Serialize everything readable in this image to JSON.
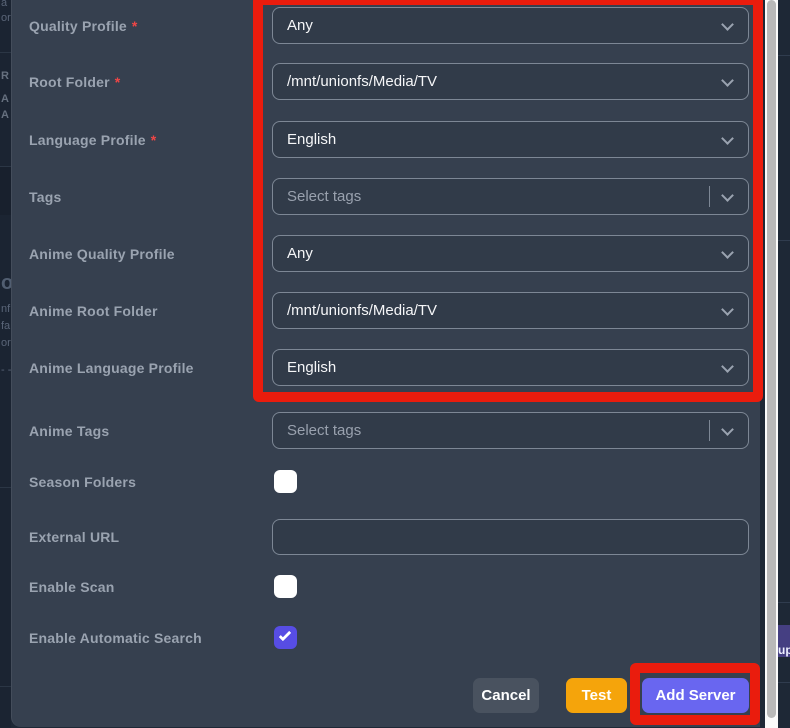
{
  "colors": {
    "annotation_red": "#ea1c0d",
    "panel_bg": "#36404f",
    "page_bg": "#1e2836",
    "add_server_indigo": "#6966f0",
    "checkbox_checked_indigo": "#574de4",
    "test_amber": "#f5a40b",
    "cancel_gray": "#49525f",
    "scrollbar_thumb_gray": "#b9b9b9"
  },
  "form": {
    "required_marker": "*",
    "rows": [
      {
        "label": "Quality Profile",
        "required": true,
        "type": "select",
        "value": "Any"
      },
      {
        "label": "Root Folder",
        "required": true,
        "type": "select",
        "value": "/mnt/unionfs/Media/TV"
      },
      {
        "label": "Language Profile",
        "required": true,
        "type": "select",
        "value": "English"
      },
      {
        "label": "Tags",
        "required": false,
        "type": "multiselect",
        "placeholder": "Select tags"
      },
      {
        "label": "Anime Quality Profile",
        "required": false,
        "type": "select",
        "value": "Any"
      },
      {
        "label": "Anime Root Folder",
        "required": false,
        "type": "select",
        "value": "/mnt/unionfs/Media/TV"
      },
      {
        "label": "Anime Language Profile",
        "required": false,
        "type": "select",
        "value": "English"
      },
      {
        "label": "Anime Tags",
        "required": false,
        "type": "multiselect",
        "placeholder": "Select tags"
      },
      {
        "label": "Season Folders",
        "required": false,
        "type": "checkbox",
        "checked": false
      },
      {
        "label": "External URL",
        "required": false,
        "type": "text",
        "value": ""
      },
      {
        "label": "Enable Scan",
        "required": false,
        "type": "checkbox",
        "checked": false
      },
      {
        "label": "Enable Automatic Search",
        "required": false,
        "type": "checkbox",
        "checked": true
      }
    ]
  },
  "footer": {
    "cancel_label": "Cancel",
    "test_label": "Test",
    "add_server_label": "Add Server"
  },
  "background": {
    "right_fragment_label": "up",
    "left_fragments": [
      "a",
      "or",
      "R",
      "A",
      "A",
      "o",
      "nf",
      "fa",
      "or",
      "- -"
    ]
  }
}
